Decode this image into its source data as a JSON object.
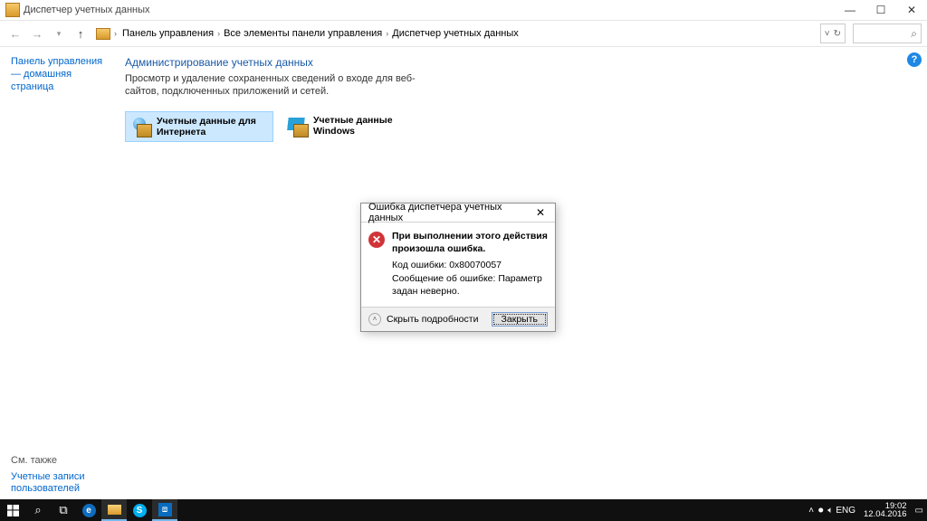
{
  "window": {
    "title": "Диспетчер учетных данных"
  },
  "breadcrumb": {
    "items": [
      "Панель управления",
      "Все элементы панели управления",
      "Диспетчер учетных данных"
    ]
  },
  "sidebar": {
    "cphome": "Панель управления — домашняя страница",
    "seealso_heading": "См. также",
    "seealso_link": "Учетные записи пользователей"
  },
  "content": {
    "heading": "Администрирование учетных данных",
    "description": "Просмотр и удаление сохраненных сведений о входе для веб-сайтов, подключенных приложений и сетей.",
    "tile_web": "Учетные данные для Интернета",
    "tile_windows": "Учетные данные Windows"
  },
  "dialog": {
    "title": "Ошибка диспетчера учетных данных",
    "message_bold": "При выполнении этого действия произошла ошибка.",
    "error_code_line": "Код ошибки: 0x80070057",
    "error_msg_line": "Сообщение об ошибке: Параметр задан неверно.",
    "details_label": "Скрыть подробности",
    "close_button": "Закрыть"
  },
  "taskbar": {
    "lang": "ENG",
    "time": "19:02",
    "date": "12.04.2016"
  }
}
